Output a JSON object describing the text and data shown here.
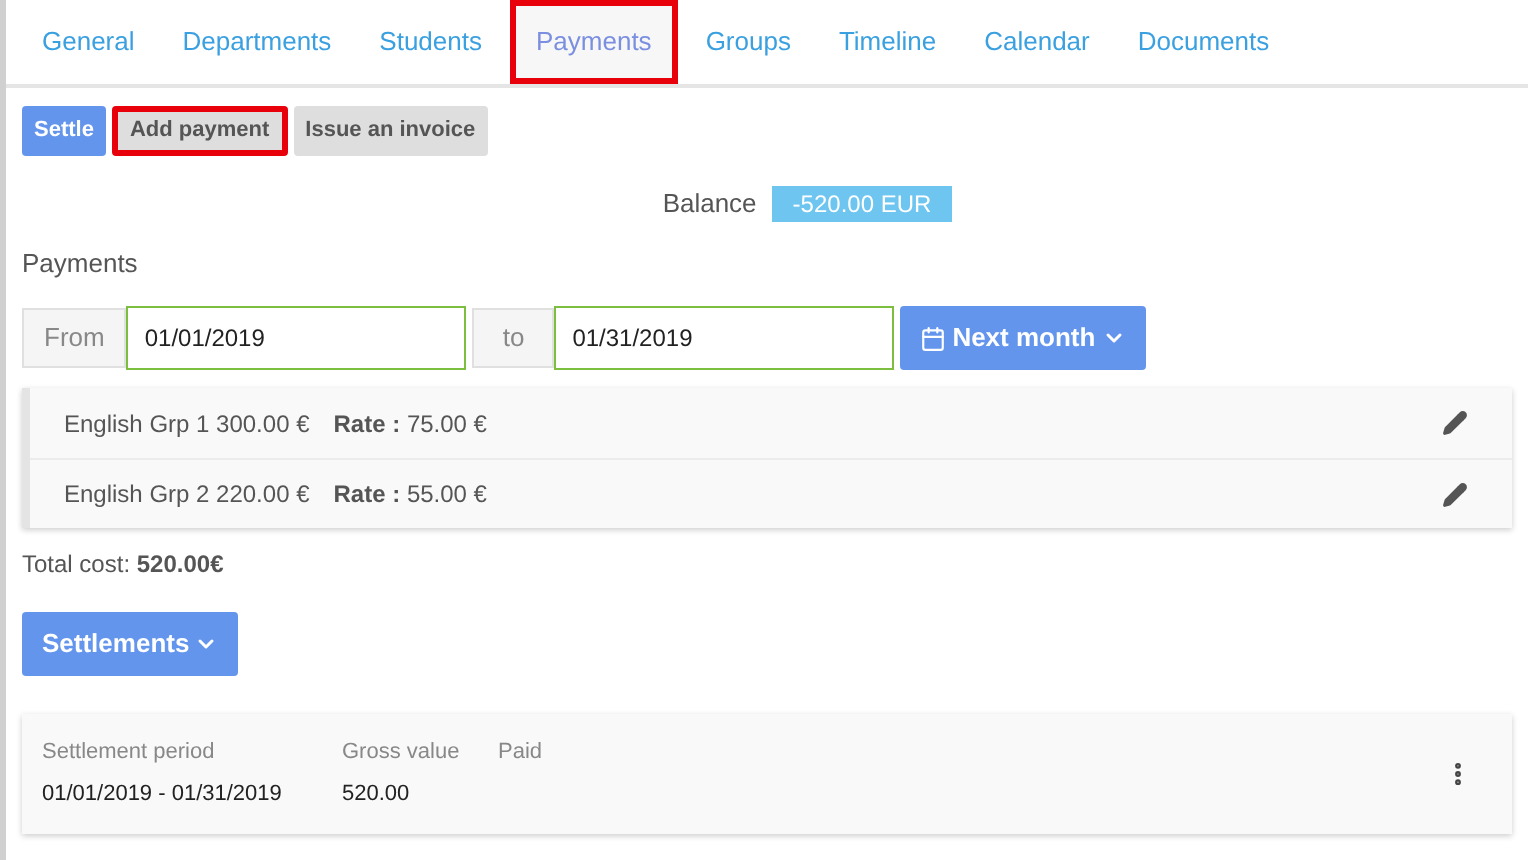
{
  "tabs": [
    {
      "label": "General",
      "selected": false,
      "highlighted": false
    },
    {
      "label": "Departments",
      "selected": false,
      "highlighted": false
    },
    {
      "label": "Students",
      "selected": false,
      "highlighted": false
    },
    {
      "label": "Payments",
      "selected": true,
      "highlighted": true
    },
    {
      "label": "Groups",
      "selected": false,
      "highlighted": false
    },
    {
      "label": "Timeline",
      "selected": false,
      "highlighted": false
    },
    {
      "label": "Calendar",
      "selected": false,
      "highlighted": false
    },
    {
      "label": "Documents",
      "selected": false,
      "highlighted": false
    }
  ],
  "actions": [
    {
      "label": "Settle",
      "kind": "primary",
      "highlighted": false
    },
    {
      "label": "Add payment",
      "kind": "secondary",
      "highlighted": true
    },
    {
      "label": "Issue an invoice",
      "kind": "secondary",
      "highlighted": false
    }
  ],
  "balance": {
    "label": "Balance",
    "value": "-520.00 EUR"
  },
  "payments": {
    "title": "Payments",
    "from_label": "From",
    "from_value": "01/01/2019",
    "to_label": "to",
    "to_value": "01/31/2019",
    "period_button": "Next month",
    "rows": [
      {
        "name": "English Grp 1 300.00 €",
        "rate_label": "Rate :",
        "rate": "75.00 €"
      },
      {
        "name": "English Grp 2 220.00 €",
        "rate_label": "Rate :",
        "rate": "55.00 €"
      }
    ],
    "total_label": "Total cost:",
    "total_value": "520.00€"
  },
  "settlements": {
    "button": "Settlements",
    "columns": [
      "Settlement period",
      "Gross value",
      "Paid"
    ],
    "rows": [
      {
        "cells": [
          "01/01/2019 - 01/31/2019",
          "520.00"
        ]
      }
    ]
  }
}
